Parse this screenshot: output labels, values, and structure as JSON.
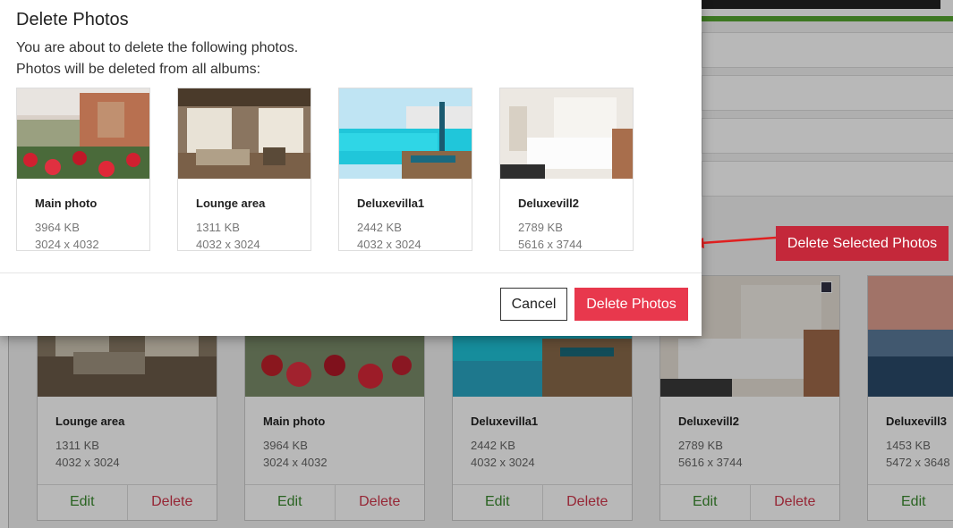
{
  "modal": {
    "title": "Delete Photos",
    "message_line1": "You are about to delete the following photos.",
    "message_line2": "Photos will be deleted from all albums:",
    "photos": [
      {
        "name": "Main photo",
        "size": "3964 KB",
        "dims": "3024 x 4032"
      },
      {
        "name": "Lounge area",
        "size": "1311 KB",
        "dims": "4032 x 3024"
      },
      {
        "name": "Deluxevilla1",
        "size": "2442 KB",
        "dims": "4032 x 3024"
      },
      {
        "name": "Deluxevill2",
        "size": "2789 KB",
        "dims": "5616 x 3744"
      }
    ],
    "cancel_label": "Cancel",
    "delete_label": "Delete Photos"
  },
  "background": {
    "delete_selected_label": "Delete Selected Photos",
    "cards": [
      {
        "name": "Lounge area",
        "size": "1311 KB",
        "dims": "4032 x 3024",
        "edit": "Edit",
        "delete": "Delete"
      },
      {
        "name": "Main photo",
        "size": "3964 KB",
        "dims": "3024 x 4032",
        "edit": "Edit",
        "delete": "Delete"
      },
      {
        "name": "Deluxevilla1",
        "size": "2442 KB",
        "dims": "4032 x 3024",
        "edit": "Edit",
        "delete": "Delete"
      },
      {
        "name": "Deluxevill2",
        "size": "2789 KB",
        "dims": "5616 x 3744",
        "edit": "Edit",
        "delete": "Delete"
      },
      {
        "name": "Deluxevill3",
        "size": "1453 KB",
        "dims": "5472 x 3648",
        "edit": "Edit",
        "delete": "Delete"
      }
    ]
  },
  "colors": {
    "delete_accent": "#e8384d",
    "arrow": "#e02020",
    "edit_green": "#3a8a2e"
  }
}
